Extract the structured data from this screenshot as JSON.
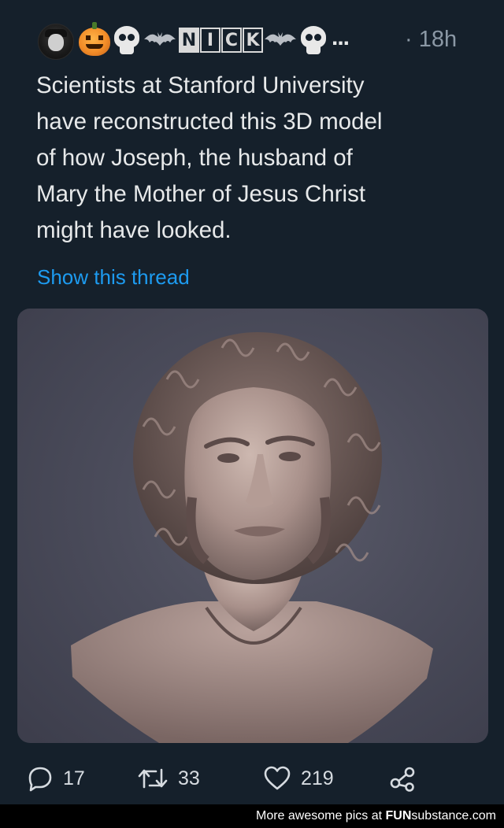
{
  "tweet": {
    "time": "· 18h",
    "text": "Scientists at Stanford University\nhave reconstructed this 3D model\nof how Joseph, the husband of\nMary the Mother of Jesus Christ\nmight have looked.",
    "show_thread": "Show this thread",
    "display_name": {
      "letters": [
        "N",
        "I",
        "C",
        "K"
      ],
      "emoji": [
        "pumpkin-icon",
        "skull-icon",
        "bat-icon",
        "skull-icon"
      ],
      "truncation": "..."
    }
  },
  "actions": {
    "replies": "17",
    "retweets": "33",
    "likes": "219"
  },
  "footer": {
    "prefix": "More awesome pics at ",
    "brand_bold": "FUN",
    "brand_rest": "substance.com"
  },
  "colors": {
    "background": "#15202b",
    "text": "#e7e9ea",
    "muted": "#8b98a5",
    "link": "#1d9bf0"
  }
}
